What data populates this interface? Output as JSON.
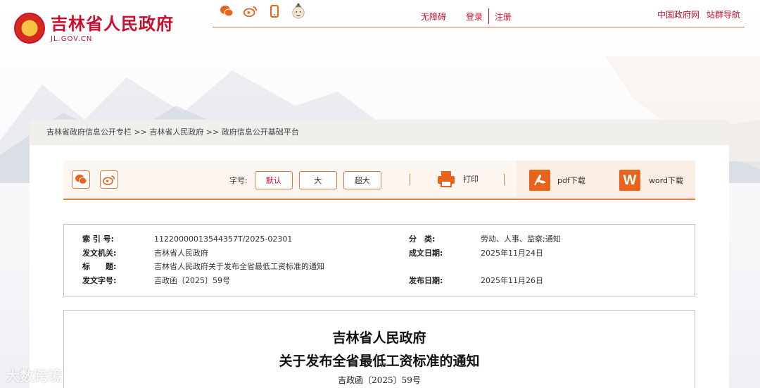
{
  "header": {
    "site_title": "吉林省人民政府",
    "site_domain": "JL.GOV.CN",
    "top_links": {
      "accessibility": "无障碍",
      "login": "登录",
      "register": "注册"
    },
    "right_links": {
      "gov": "中国政府网",
      "nav": "站群导航"
    }
  },
  "breadcrumb": "吉林省政府信息公开专栏 >> 吉林省人民政府 >> 政府信息公开基础平台",
  "toolbar": {
    "font_label": "字号:",
    "font_default": "默认",
    "font_large": "大",
    "font_xlarge": "超大",
    "print": "打印",
    "pdf": "pdf下载",
    "word": "word下载"
  },
  "info": {
    "index_label": "索 引 号:",
    "index_value": "11220000013544357T/2025-02301",
    "issuer_label": "发文机关:",
    "issuer_value": "吉林省人民政府",
    "title_label": "标　　题:",
    "title_value": "吉林省人民政府关于发布全省最低工资标准的通知",
    "docno_label": "发文字号:",
    "docno_value": "吉政函〔2025〕59号",
    "category_label": "分　类:",
    "category_value": "劳动、人事、监察;通知",
    "created_label": "成文日期:",
    "created_value": "2025年11月24日",
    "published_label": "发布日期:",
    "published_value": "2025年11月26日"
  },
  "document": {
    "heading1": "吉林省人民政府",
    "heading2": "关于发布全省最低工资标准的通知",
    "doc_number": "吉政函〔2025〕59号"
  },
  "watermark": "大数跨境",
  "colors": {
    "brand_red": "#c8102e",
    "accent_orange": "#e07b39",
    "download_orange": "#e8641a"
  }
}
